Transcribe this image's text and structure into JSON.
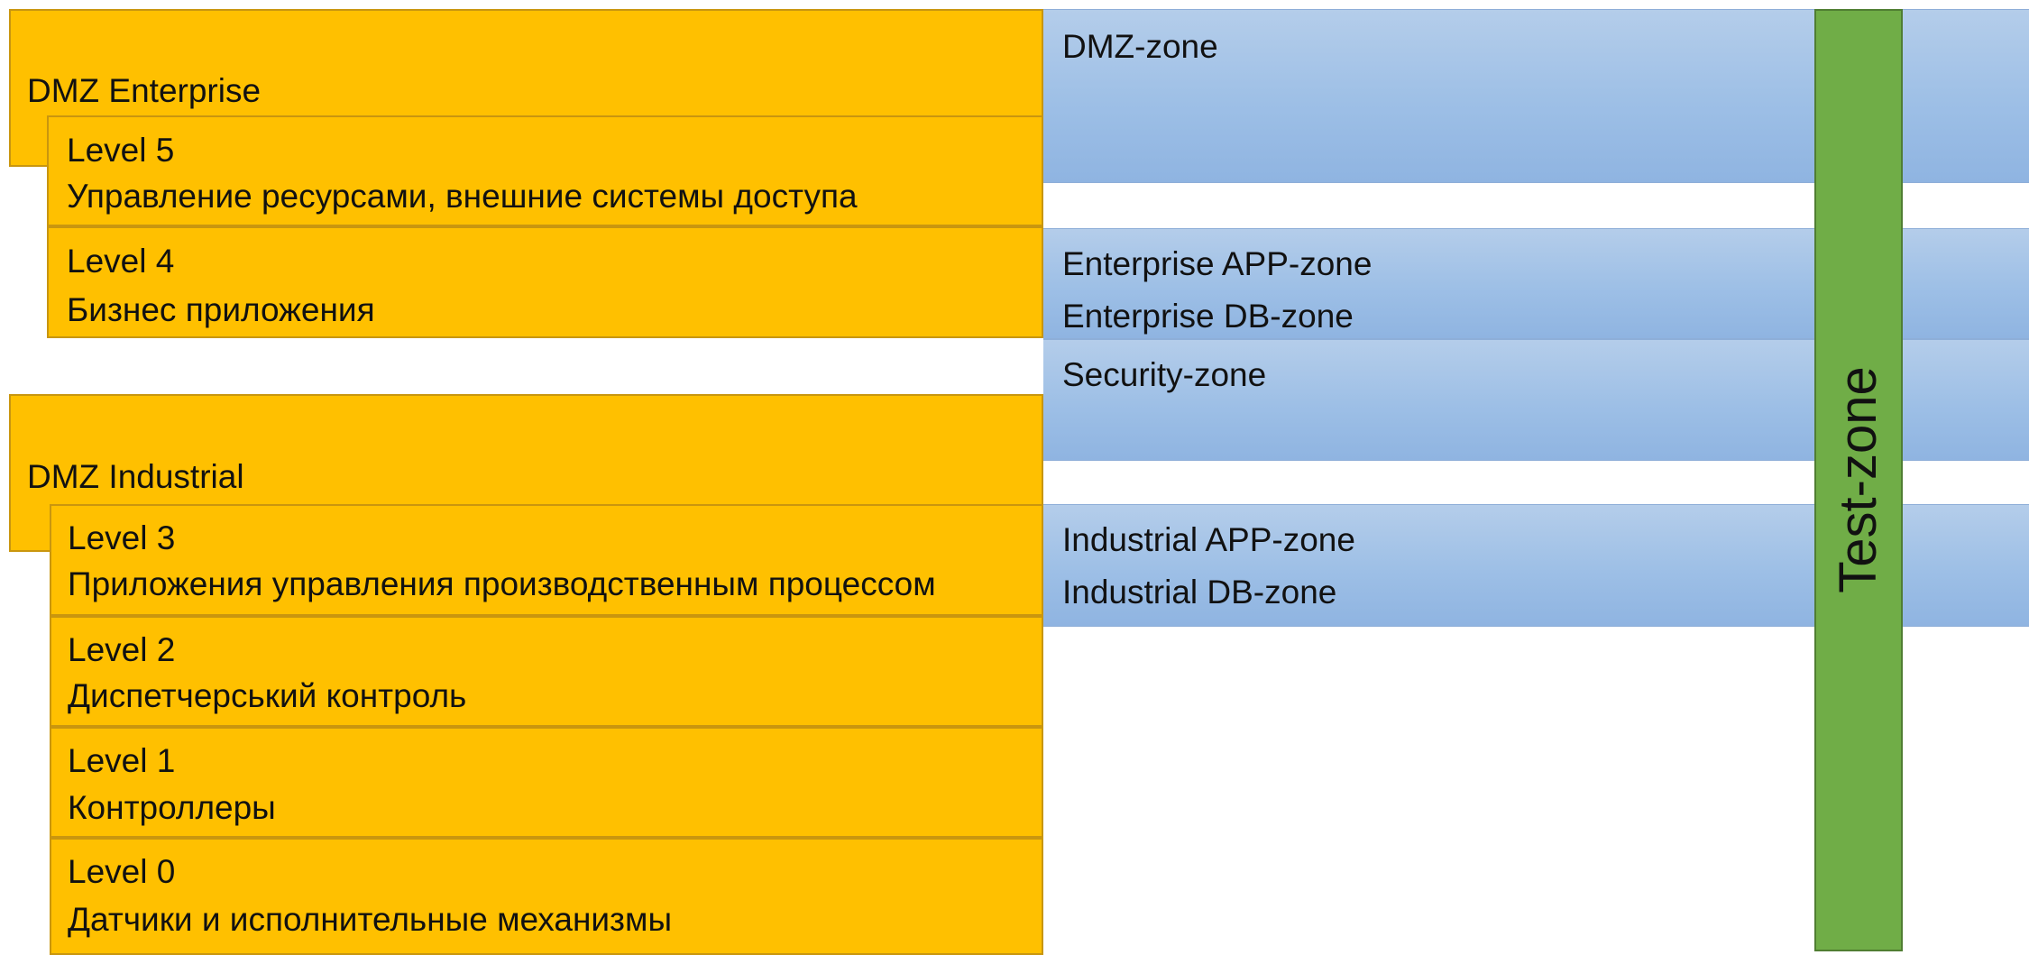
{
  "dmz_enterprise": {
    "title": "DMZ Enterprise"
  },
  "dmz_industrial": {
    "title": "DMZ Industrial"
  },
  "levels": [
    {
      "level": "Level 5",
      "description": "Управление ресурсами, внешние системы доступа"
    },
    {
      "level": "Level 4",
      "description": "Бизнес приложения"
    },
    {
      "level": "Level 3",
      "description": "Приложения управления производственным процессом"
    },
    {
      "level": "Level 2",
      "description": "Диспетчерський контроль"
    },
    {
      "level": "Level 1",
      "description": "Контроллеры"
    },
    {
      "level": "Level 0",
      "description": "Датчики и исполнительные механизмы"
    }
  ],
  "zones": {
    "dmz": "DMZ-zone",
    "enterprise_app": "Enterprise APP-zone",
    "enterprise_db": "Enterprise DB-zone",
    "security": "Security-zone",
    "industrial_app": "Industrial APP-zone",
    "industrial_db": "Industrial DB-zone",
    "test": "Test-zone"
  },
  "colors": {
    "levels_fill": "#ffc000",
    "zones_fill": "#9dc3e6",
    "test_zone_fill": "#70ad47"
  }
}
